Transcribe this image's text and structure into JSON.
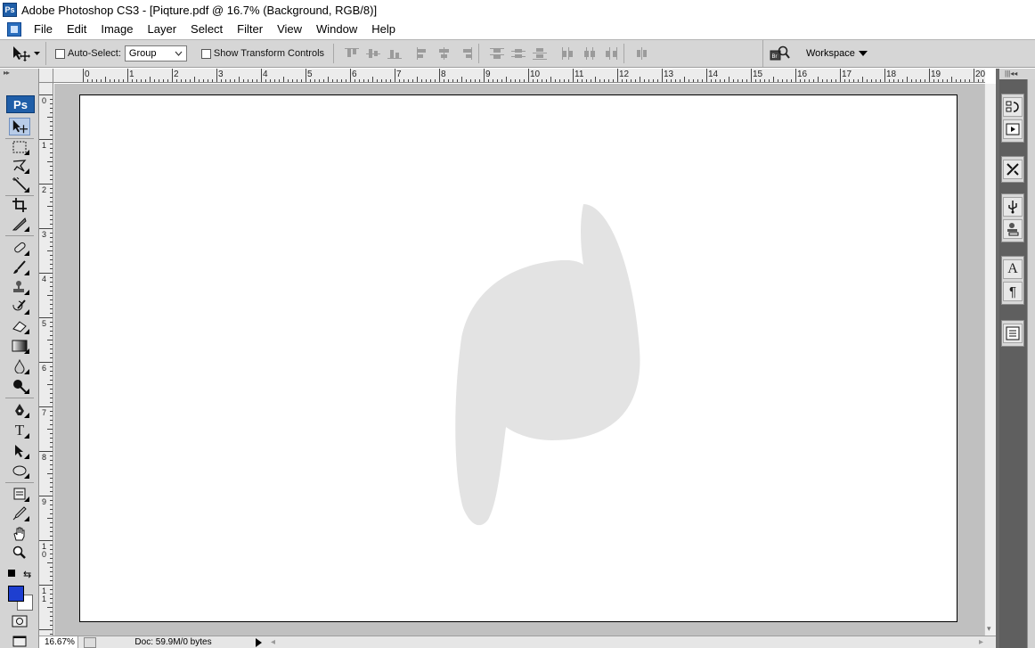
{
  "window": {
    "badge": "Ps",
    "title": "Adobe Photoshop CS3 - [Piqture.pdf @ 16.7% (Background, RGB/8)]"
  },
  "menu": {
    "items": [
      "File",
      "Edit",
      "Image",
      "Layer",
      "Select",
      "Filter",
      "View",
      "Window",
      "Help"
    ]
  },
  "options": {
    "auto_select_label": "Auto-Select:",
    "auto_select_value": "Group",
    "show_transform_label": "Show Transform Controls",
    "workspace_label": "Workspace"
  },
  "toolbox": {
    "logo": "Ps",
    "text_tool_glyph": "T",
    "foreground_color": "#1e3fd0",
    "background_color": "#ffffff"
  },
  "ruler": {
    "top_labels": [
      "0",
      "1",
      "2",
      "3",
      "4",
      "5",
      "6",
      "7",
      "8",
      "9",
      "10",
      "11",
      "12",
      "13",
      "14",
      "15",
      "16",
      "17",
      "18",
      "19",
      "20"
    ],
    "left_labels": [
      "0",
      "1",
      "2",
      "3",
      "4",
      "5",
      "6",
      "7",
      "8",
      "9",
      "10",
      "11"
    ]
  },
  "canvas": {
    "shape_color": "#e3e3e3"
  },
  "status": {
    "zoom": "16.67%",
    "doc_info": "Doc: 59.9M/0 bytes"
  },
  "dock": {
    "type_glyph": "A",
    "paragraph_glyph": "¶"
  }
}
